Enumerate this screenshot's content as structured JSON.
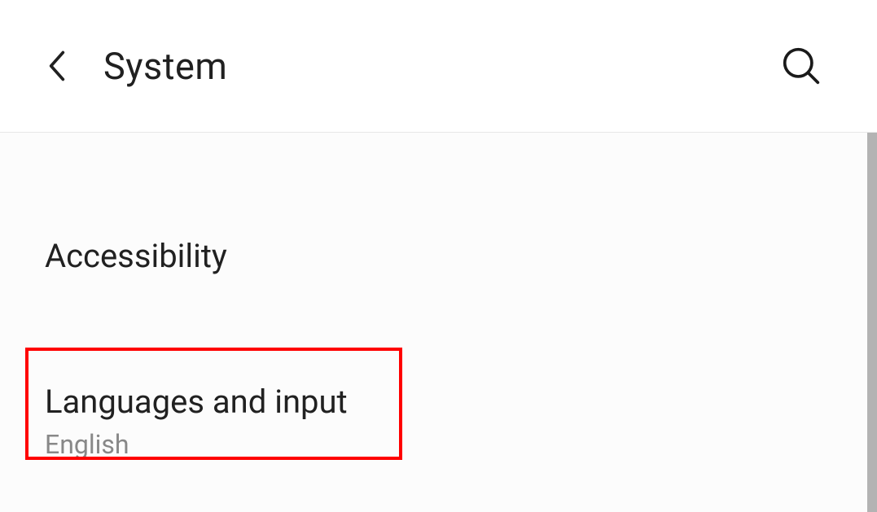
{
  "header": {
    "title": "System"
  },
  "items": [
    {
      "title": "Accessibility",
      "subtitle": null
    },
    {
      "title": "Languages and input",
      "subtitle": "English"
    }
  ]
}
